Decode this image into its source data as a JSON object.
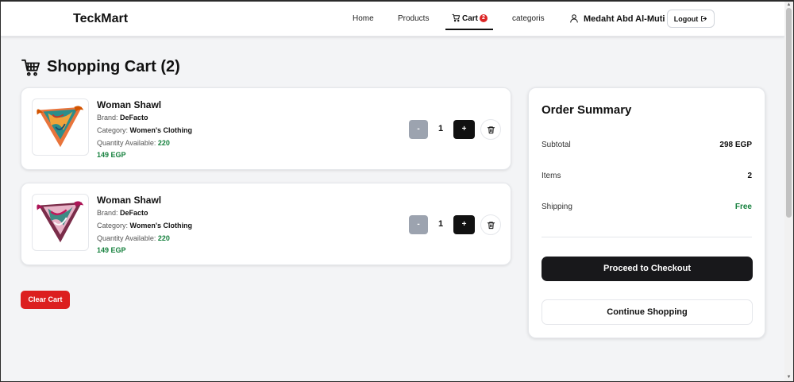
{
  "navbar": {
    "brand": "TeckMart",
    "links": {
      "home": "Home",
      "products": "Products",
      "cart": "Cart",
      "categories": "categoris"
    },
    "cart_count": "2",
    "user_name": "Medaht Abd Al-Muti",
    "logout_label": "Logout"
  },
  "page": {
    "title": "Shopping Cart (2)"
  },
  "cart_items": [
    {
      "name": "Woman Shawl",
      "brand_label": "Brand:",
      "brand": "DeFacto",
      "category_label": "Category:",
      "category": "Women's Clothing",
      "qty_available_label": "Quantity Available:",
      "qty_available": "220",
      "price": "149 EGP",
      "minus": "-",
      "quantity": "1",
      "plus": "+"
    },
    {
      "name": "Woman Shawl",
      "brand_label": "Brand:",
      "brand": "DeFacto",
      "category_label": "Category:",
      "category": "Women's Clothing",
      "qty_available_label": "Quantity Available:",
      "qty_available": "220",
      "price": "149 EGP",
      "minus": "-",
      "quantity": "1",
      "plus": "+"
    }
  ],
  "clear_cart_label": "Clear Cart",
  "summary": {
    "title": "Order Summary",
    "subtotal_label": "Subtotal",
    "subtotal": "298 EGP",
    "items_label": "Items",
    "items": "2",
    "shipping_label": "Shipping",
    "shipping": "Free",
    "checkout_label": "Proceed to Checkout",
    "continue_label": "Continue Shopping"
  },
  "colors": {
    "accent": "#18181b",
    "danger": "#dc1f1f",
    "price_green": "#15803d",
    "background": "#f3f4f6"
  },
  "icons": [
    "cart-icon",
    "user-icon",
    "logout-icon",
    "shopping-cart-icon",
    "trash-icon"
  ]
}
